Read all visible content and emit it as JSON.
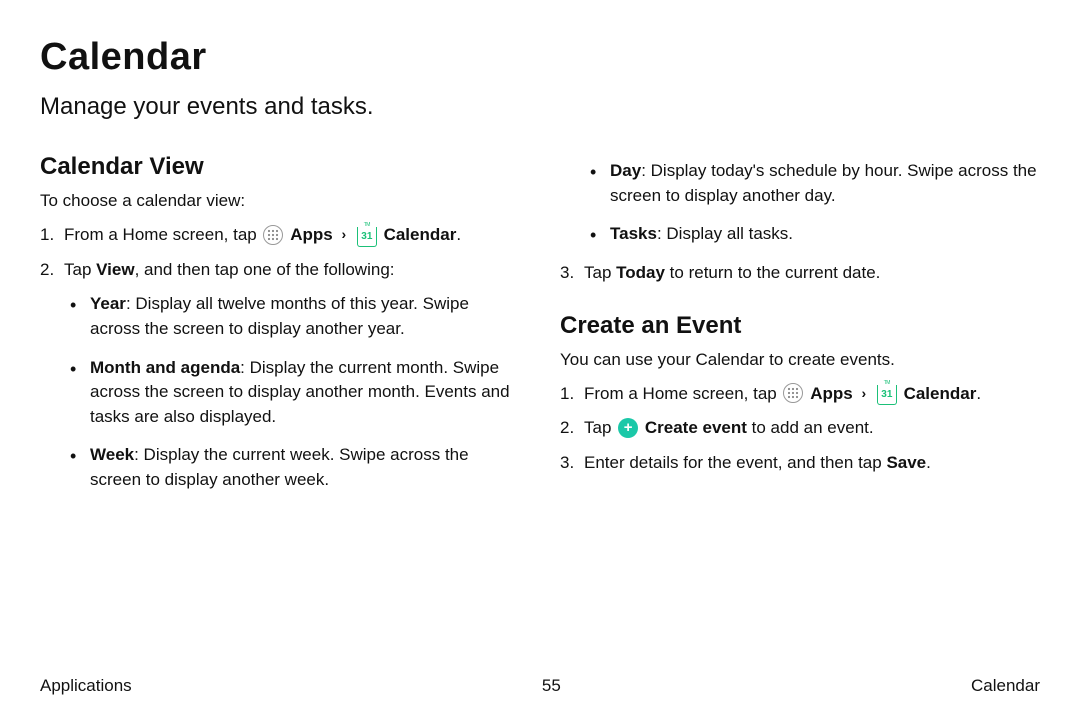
{
  "title": "Calendar",
  "subtitle": "Manage your events and tasks.",
  "icons": {
    "apps": "apps-grid-icon",
    "calendar": "calendar-31-icon",
    "plus": "plus-icon",
    "calendar_day": "31",
    "calendar_tm": "TM"
  },
  "labels": {
    "apps": "Apps",
    "calendar": "Calendar",
    "chevron": "›",
    "create_event": "Create event"
  },
  "left": {
    "section_title": "Calendar View",
    "intro": "To choose a calendar view:",
    "step1_pre": "From a Home screen, tap ",
    "step1_end": ".",
    "step2_a": "Tap ",
    "step2_b": "View",
    "step2_c": ", and then tap one of the following:",
    "bullets": {
      "b1_a": "Year",
      "b1_b": ": Display all twelve months of this year. Swipe across the screen to display another year.",
      "b2_a": "Month and agenda",
      "b2_b": ": Display the current month. Swipe across the screen to display another month. Events and tasks are also displayed.",
      "b3_a": "Week",
      "b3_b": ": Display the current week. Swipe across the screen to display another week."
    }
  },
  "right": {
    "bullets": {
      "b4_a": "Day",
      "b4_b": ": Display today's schedule by hour. Swipe across the screen to display another day.",
      "b5_a": "Tasks",
      "b5_b": ": Display all tasks."
    },
    "step3_a": "Tap ",
    "step3_b": "Today",
    "step3_c": " to return to the current date.",
    "section2_title": "Create an Event",
    "section2_intro": "You can use your Calendar to create events.",
    "e_step1_pre": "From a Home screen, tap ",
    "e_step1_end": ".",
    "e_step2_a": "Tap ",
    "e_step2_c": " to add an event.",
    "e_step3_a": "Enter details for the event, and then tap ",
    "e_step3_b": "Save",
    "e_step3_c": "."
  },
  "footer": {
    "left": "Applications",
    "center": "55",
    "right": "Calendar"
  }
}
